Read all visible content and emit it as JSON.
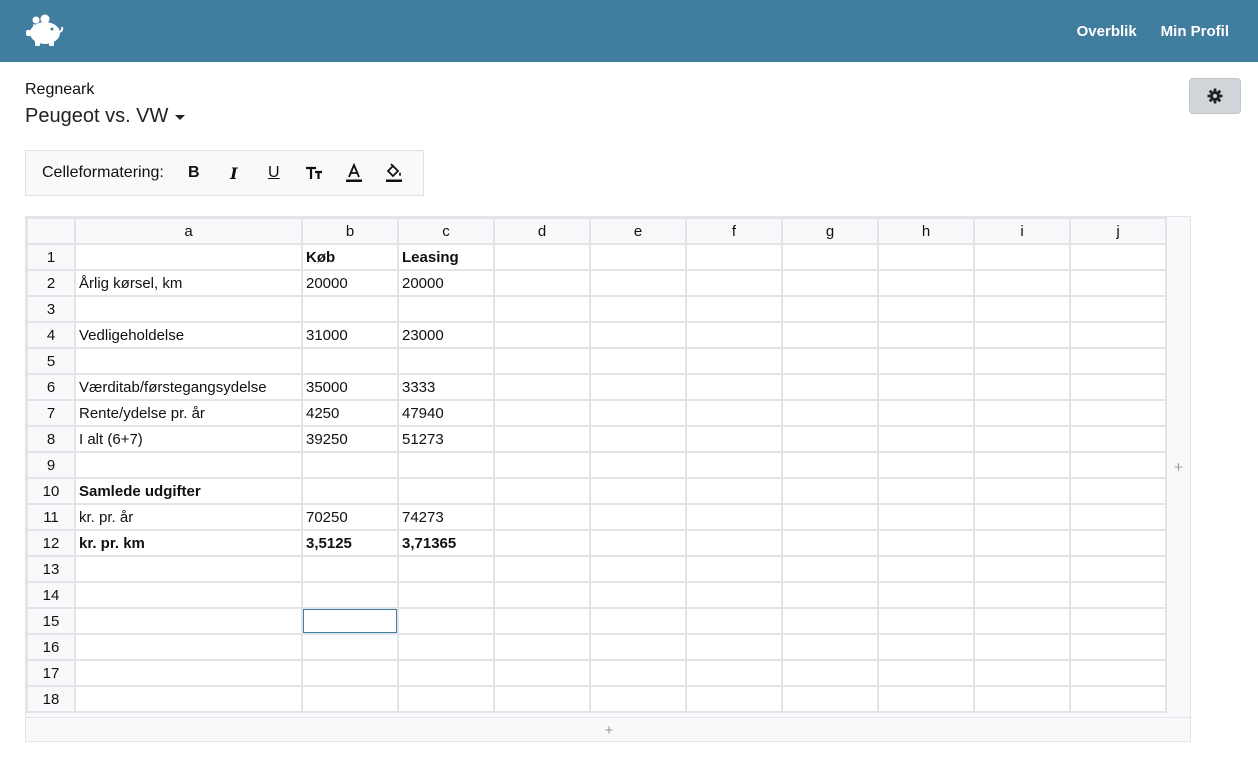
{
  "nav": {
    "links": [
      "Overblik",
      "Min Profil"
    ]
  },
  "header": {
    "label": "Regneark",
    "title": "Peugeot vs. VW"
  },
  "toolbar": {
    "label": "Celleformatering:",
    "buttons": [
      {
        "name": "bold-button",
        "icon": "bold-icon",
        "glyph": "B"
      },
      {
        "name": "italic-button",
        "icon": "italic-icon",
        "glyph": "I"
      },
      {
        "name": "underline-button",
        "icon": "underline-icon",
        "glyph": "U"
      },
      {
        "name": "text-size-button",
        "icon": "text-height-icon"
      },
      {
        "name": "font-color-button",
        "icon": "font-color-icon"
      },
      {
        "name": "fill-color-button",
        "icon": "fill-color-icon"
      }
    ]
  },
  "grid": {
    "columns": [
      "a",
      "b",
      "c",
      "d",
      "e",
      "f",
      "g",
      "h",
      "i",
      "j"
    ],
    "rows": [
      {
        "n": "1",
        "cells": [
          "",
          "Køb",
          "Leasing"
        ],
        "bold": [
          false,
          true,
          true
        ]
      },
      {
        "n": "2",
        "cells": [
          "Årlig kørsel, km",
          "20000",
          "20000"
        ]
      },
      {
        "n": "3",
        "cells": [
          "",
          "",
          ""
        ]
      },
      {
        "n": "4",
        "cells": [
          "Vedligeholdelse",
          "31000",
          "23000"
        ]
      },
      {
        "n": "5",
        "cells": [
          "",
          "",
          ""
        ]
      },
      {
        "n": "6",
        "cells": [
          "Værditab/førstegangsydelse",
          "35000",
          "3333"
        ]
      },
      {
        "n": "7",
        "cells": [
          "Rente/ydelse pr. år",
          "4250",
          "47940"
        ]
      },
      {
        "n": "8",
        "cells": [
          "I alt (6+7)",
          "39250",
          "51273"
        ]
      },
      {
        "n": "9",
        "cells": [
          "",
          "",
          ""
        ]
      },
      {
        "n": "10",
        "cells": [
          "Samlede udgifter",
          "",
          ""
        ],
        "big": [
          true,
          false,
          false
        ]
      },
      {
        "n": "11",
        "cells": [
          "kr. pr. år",
          "70250",
          "74273"
        ]
      },
      {
        "n": "12",
        "cells": [
          "kr. pr. km",
          "3,5125",
          "3,71365"
        ],
        "bold": [
          true,
          true,
          true
        ]
      },
      {
        "n": "13",
        "cells": [
          "",
          "",
          ""
        ]
      },
      {
        "n": "14",
        "cells": [
          "",
          "",
          ""
        ]
      },
      {
        "n": "15",
        "cells": [
          "",
          "",
          ""
        ],
        "selected": 1
      },
      {
        "n": "16",
        "cells": [
          "",
          "",
          ""
        ]
      },
      {
        "n": "17",
        "cells": [
          "",
          "",
          ""
        ]
      },
      {
        "n": "18",
        "cells": [
          "",
          "",
          ""
        ]
      }
    ],
    "add_column_label": "+",
    "add_row_label": "+"
  },
  "colors": {
    "navbar": "#417d9e",
    "selection": "#3e7ea3"
  }
}
